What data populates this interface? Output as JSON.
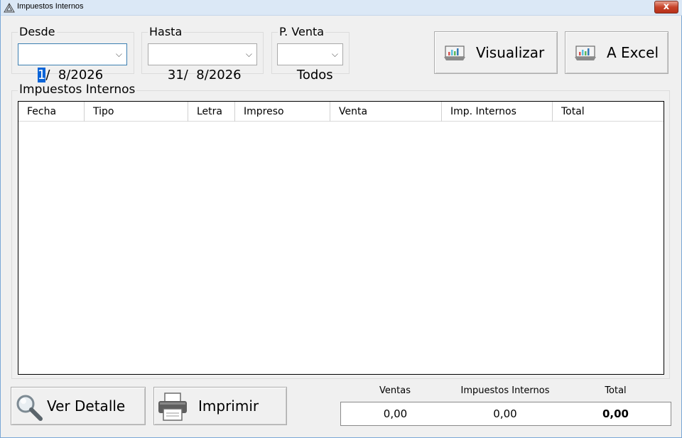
{
  "window": {
    "title": "Impuestos Internos",
    "close_label": "x"
  },
  "filters": {
    "desde": {
      "label": "Desde",
      "day": "1",
      "rest": "/  8/2026"
    },
    "hasta": {
      "label": "Hasta",
      "value": "31/  8/2026"
    },
    "punto_venta": {
      "label": "P. Venta",
      "value": "Todos"
    }
  },
  "toolbar": {
    "visualizar_label": "Visualizar",
    "excel_label": "A Excel"
  },
  "grid": {
    "group_label": "Impuestos Internos",
    "columns": [
      "Fecha",
      "Tipo",
      "Letra",
      "Impreso",
      "Venta",
      "Imp. Internos",
      "Total"
    ],
    "rows": []
  },
  "footer": {
    "ver_detalle_label": "Ver Detalle",
    "imprimir_label": "Imprimir"
  },
  "totals": {
    "ventas_label": "Ventas",
    "ventas_value": "0,00",
    "imp_label": "Impuestos Internos",
    "imp_value": "0,00",
    "total_label": "Total",
    "total_value": "0,00"
  },
  "colors": {
    "titlebar": "#dbe8f6",
    "close": "#c7432a",
    "selection": "#0a64d8",
    "window_bg": "#f0f0f0"
  }
}
